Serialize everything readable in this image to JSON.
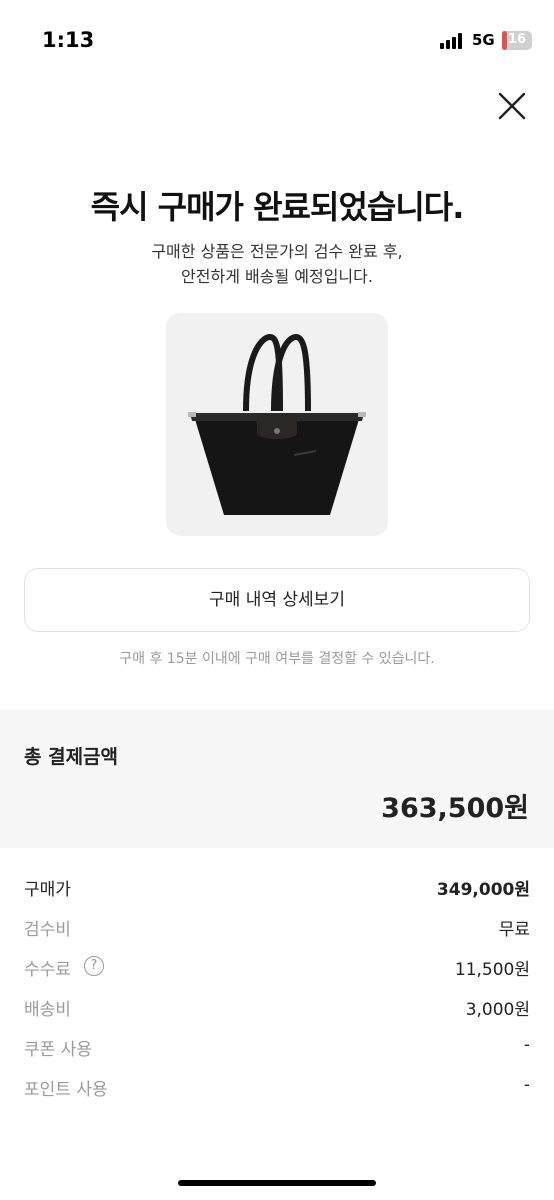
{
  "status_bar": {
    "time": "1:13",
    "network": "5G",
    "battery": "16",
    "battery_level_percent": 16
  },
  "close_icon": "close-icon",
  "headline": "즉시 구매가 완료되었습니다.",
  "subtext": {
    "line1": "구매한 상품은 전문가의 검수 완료 후,",
    "line2": "안전하게 배송될 예정입니다."
  },
  "detail_button_label": "구매 내역 상세보기",
  "notice": "구매 후 15분 이내에 구매 여부를 결정할 수 있습니다.",
  "total": {
    "label": "총 결제금액",
    "amount": "363,500원"
  },
  "breakdown": [
    {
      "label": "구매가",
      "value": "349,000원"
    },
    {
      "label": "검수비",
      "value": "무료"
    },
    {
      "label": "수수료",
      "value": "11,500원",
      "help_icon": "?"
    },
    {
      "label": "배송비",
      "value": "3,000원"
    },
    {
      "label": "쿠폰 사용",
      "value": "-"
    },
    {
      "label": "포인트 사용",
      "value": "-"
    }
  ],
  "colors": {
    "battery_low": "#e2514e",
    "muted_text": "#9a9a9a",
    "section_bg": "#f6f6f6"
  }
}
